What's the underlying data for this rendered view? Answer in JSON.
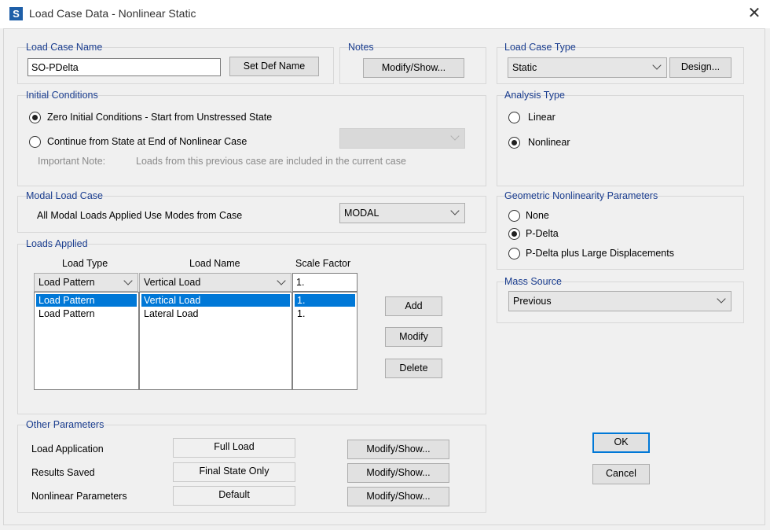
{
  "window": {
    "icon_letter": "S",
    "title": "Load Case Data - Nonlinear Static",
    "close_glyph": "✕"
  },
  "load_case_name": {
    "label": "Load Case Name",
    "value": "SO-PDelta",
    "set_def_name": "Set Def Name"
  },
  "notes": {
    "label": "Notes",
    "button": "Modify/Show..."
  },
  "load_case_type": {
    "label": "Load Case Type",
    "selected": "Static",
    "design_button": "Design..."
  },
  "initial_conditions": {
    "label": "Initial Conditions",
    "option_zero": "Zero Initial Conditions - Start from Unstressed State",
    "option_continue": "Continue from State at End of Nonlinear Case",
    "note_label": "Important Note:",
    "note_text": "Loads from this previous case are included in the current case",
    "continue_case_selected": ""
  },
  "analysis_type": {
    "label": "Analysis Type",
    "linear": "Linear",
    "nonlinear": "Nonlinear"
  },
  "modal_load_case": {
    "label": "Modal Load Case",
    "text": "All Modal Loads Applied Use Modes from Case",
    "selected": "MODAL"
  },
  "geometric_nonlinearity": {
    "label": "Geometric Nonlinearity Parameters",
    "none": "None",
    "pdelta": "P-Delta",
    "pdelta_large": "P-Delta plus Large Displacements"
  },
  "loads_applied": {
    "label": "Loads Applied",
    "col_load_type": "Load Type",
    "col_load_name": "Load Name",
    "col_scale_factor": "Scale Factor",
    "edit_load_type": "Load Pattern",
    "edit_load_name": "Vertical Load",
    "edit_scale_factor": "1.",
    "rows": [
      {
        "load_type": "Load Pattern",
        "load_name": "Vertical Load",
        "scale_factor": "1."
      },
      {
        "load_type": "Load Pattern",
        "load_name": "Lateral Load",
        "scale_factor": "1."
      }
    ],
    "add": "Add",
    "modify": "Modify",
    "delete": "Delete"
  },
  "mass_source": {
    "label": "Mass Source",
    "selected": "Previous"
  },
  "other_parameters": {
    "label": "Other Parameters",
    "load_application_label": "Load Application",
    "load_application_value": "Full Load",
    "results_saved_label": "Results Saved",
    "results_saved_value": "Final State Only",
    "nonlinear_parameters_label": "Nonlinear Parameters",
    "nonlinear_parameters_value": "Default",
    "modify_show": "Modify/Show..."
  },
  "dialog_buttons": {
    "ok": "OK",
    "cancel": "Cancel"
  },
  "colors": {
    "group_label": "#1a3d8f",
    "selection": "#0078d7",
    "app_icon": "#1e5fa8"
  }
}
